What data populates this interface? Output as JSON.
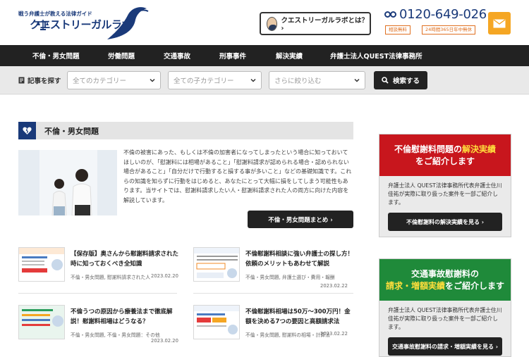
{
  "header": {
    "logo_tagline": "戦う弁護士が教える法律ガイド",
    "logo_title": "クエストリーガルラボ",
    "about_button": "クエストリーガルラボとは？ ›",
    "phone": "0120-649-026",
    "badge_free": "相談無料",
    "badge_hours": "24時間365日年中無休",
    "colors": {
      "brand": "#1a3a7a",
      "accent_orange": "#f5a623"
    }
  },
  "nav": {
    "items": [
      "不倫・男女問題",
      "労働問題",
      "交通事故",
      "刑事事件",
      "解決実績",
      "弁護士法人QUEST法律事務所"
    ]
  },
  "search": {
    "label": "記事を探す",
    "category_placeholder": "全てのカテゴリー",
    "subcategory_placeholder": "全ての子カテゴリー",
    "filter_placeholder": "さらに絞り込む",
    "button": "検索する"
  },
  "main": {
    "category_title": "不倫・男女問題",
    "intro": "不倫の被害にあった、もしくは不倫の加害者になってしまったという場合に知っておいてほしいのが、「慰謝料には相場があること」「慰謝料請求が認められる場合・認められない場合があること」「自分だけで行動すると損する事が多いこと」などの基礎知識です。これらの知識を知らずに行動をはじめると、あなたにとって大幅に損をしてしまう可能性もあります。当サイトでは、慰謝料請求したい人・慰謝料請求された人の両方に向けた内容を解説しています。",
    "more_button": "不倫・男女問題まとめ ›",
    "articles": [
      {
        "title": "【保存版】奥さんから慰謝料請求された時に知っておくべき全知識",
        "meta": "不倫・男女問題, 慰謝料請求された人",
        "date": "2023.02.20"
      },
      {
        "title": "不倫慰謝料相談に強い弁護士の探し方！依頼のメリットもあわせて解説",
        "meta": "不倫・男女問題, 弁護士選び・費用・報酬",
        "date": "2023.02.22"
      },
      {
        "title": "不倫うつの原因から療養法まで徹底解説！慰謝料相場はどうなる？",
        "meta": "不倫・男女問題, 不倫・男女問題：その他",
        "date": "2023.02.20"
      },
      {
        "title": "不倫慰謝料相場は50万～300万円！金額を決める7つの要因と高額請求法",
        "meta": "不倫・男女問題, 慰謝料の相場・計算法",
        "date": "2023.02.22"
      }
    ]
  },
  "sidebar": {
    "box1": {
      "head_line1_a": "不倫慰謝料問題の",
      "head_line1_b": "解決実績",
      "head_line2": "をご紹介します",
      "text": "弁護士法人 QUEST法律事務所代表弁護士住川佳祐が実際に取り扱った案件を一部ご紹介します。",
      "button": "不倫慰謝料の解決実績を見る ›",
      "color": "#c8161d"
    },
    "box2": {
      "head_line1": "交通事故慰謝料の",
      "head_line2_a": "請求・増額実績",
      "head_line2_b": "をご紹介します",
      "text": "弁護士法人 QUEST法律事務所代表弁護士住川佳祐が実際に取り扱った案件を一部ご紹介します。",
      "button": "交通事故慰謝料の請求・増額実績を見る ›",
      "color": "#1f8a3a"
    }
  }
}
